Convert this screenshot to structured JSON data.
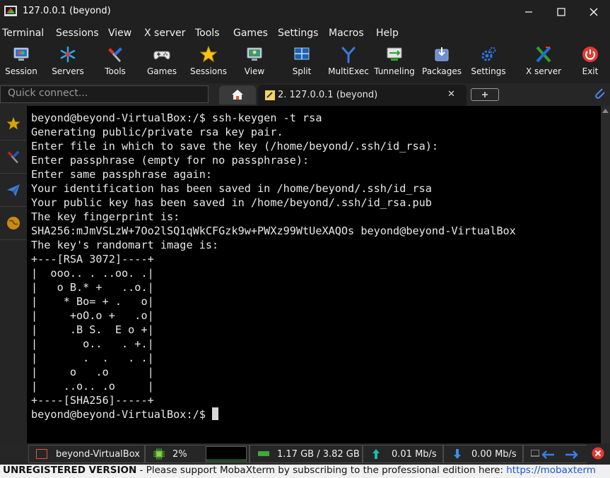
{
  "window": {
    "title": "127.0.0.1 (beyond)"
  },
  "menu": [
    "Terminal",
    "Sessions",
    "View",
    "X server",
    "Tools",
    "Games",
    "Settings",
    "Macros",
    "Help"
  ],
  "toolbar": [
    "Session",
    "Servers",
    "Tools",
    "Games",
    "Sessions",
    "View",
    "Split",
    "MultiExec",
    "Tunneling",
    "Packages",
    "Settings",
    "X server",
    "Exit"
  ],
  "quick_connect": {
    "placeholder": "Quick connect..."
  },
  "tabs": {
    "active_label": "2. 127.0.0.1 (beyond)",
    "close": "✕"
  },
  "terminal": {
    "lines": [
      "beyond@beyond-VirtualBox:/$ ssh-keygen -t rsa",
      "Generating public/private rsa key pair.",
      "Enter file in which to save the key (/home/beyond/.ssh/id_rsa):",
      "Enter passphrase (empty for no passphrase):",
      "Enter same passphrase again:",
      "Your identification has been saved in /home/beyond/.ssh/id_rsa",
      "Your public key has been saved in /home/beyond/.ssh/id_rsa.pub",
      "The key fingerprint is:",
      "SHA256:mJmVSLzW+7Oo2lSQ1qWkCFGzk9w+PWXz99WtUeXAQOs beyond@beyond-VirtualBox",
      "The key's randomart image is:",
      "+---[RSA 3072]----+",
      "|  ooo.. . ..oo. .|",
      "|   o B.* +   ..o.|",
      "|    * Bo= + .   o|",
      "|     +oO.o +   .o|",
      "|     .B S.  E o +|",
      "|       o..   . +.|",
      "|       .  .   . .|",
      "|     o   .o      |",
      "|    ..o.. .o     |",
      "+----[SHA256]-----+"
    ],
    "prompt": "beyond@beyond-VirtualBox:/$ "
  },
  "status": {
    "host": "beyond-VirtualBox",
    "cpu": "2%",
    "memory": "1.17 GB / 3.82 GB",
    "upload": "0.01 Mb/s",
    "download": "0.00 Mb/s"
  },
  "banner": {
    "label": "UNREGISTERED VERSION",
    "separator": " - ",
    "message": "Please support MobaXterm by subscribing to the professional edition here: ",
    "link": "https://mobaxterm"
  },
  "colors": {
    "background": "#202020",
    "terminal_bg": "#000000",
    "link": "#1a57c9"
  }
}
